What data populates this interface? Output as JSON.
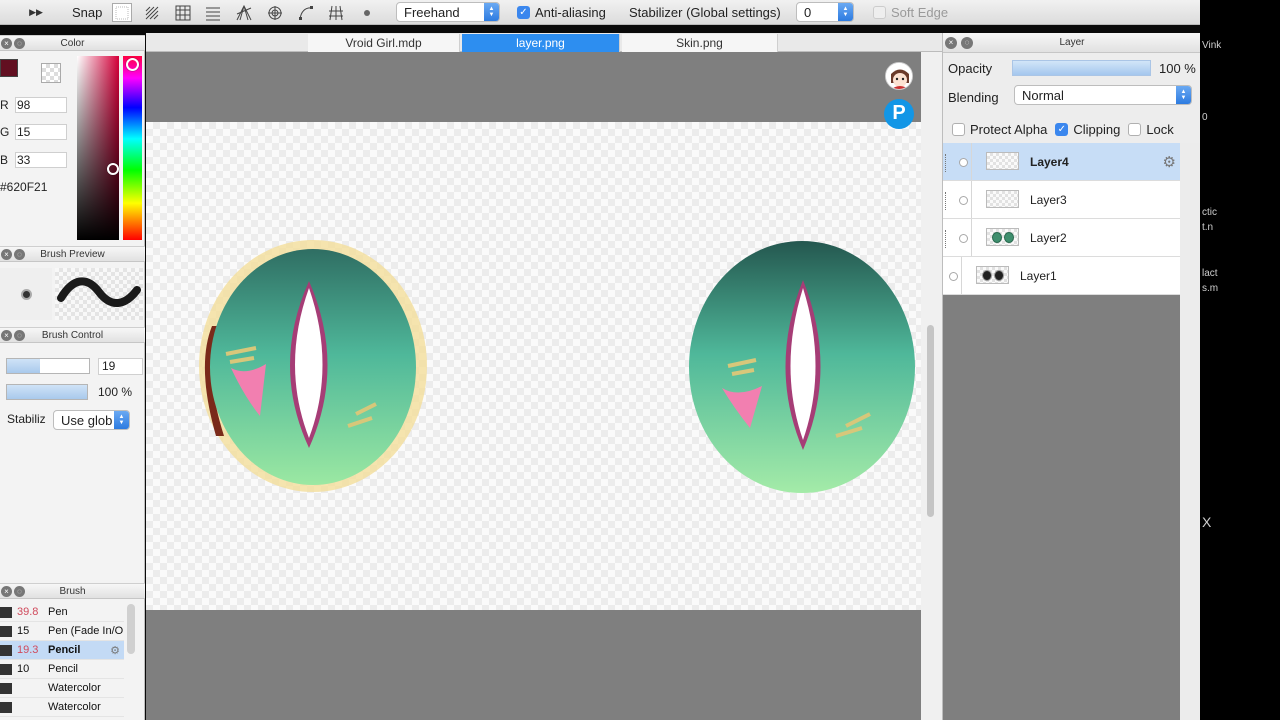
{
  "toolbar": {
    "snap_label": "Snap",
    "stroke_mode": "Freehand",
    "anti_aliasing_label": "Anti-aliasing",
    "stabilizer_label": "Stabilizer (Global settings)",
    "stabilizer_value": "0",
    "soft_edge_label": "Soft Edge"
  },
  "tabs": [
    {
      "label": "Vroid Girl.mdp",
      "active": false
    },
    {
      "label": "layer.png",
      "active": true
    },
    {
      "label": "Skin.png",
      "active": false
    }
  ],
  "color_panel": {
    "title": "Color",
    "r_label": "R",
    "r_value": "98",
    "g_label": "G",
    "g_value": "15",
    "b_label": "B",
    "b_value": "33",
    "hex": "#620F21",
    "foreground_color": "#620F21"
  },
  "brush_preview": {
    "title": "Brush Preview"
  },
  "brush_control": {
    "title": "Brush Control",
    "size_value": "19",
    "size_fraction": 0.4,
    "opacity_value": "100 %",
    "opacity_fraction": 1.0,
    "stabilizer_label": "Stabiliz",
    "stabilizer_option": "Use glob"
  },
  "brush_panel": {
    "title": "Brush",
    "items": [
      {
        "size": "39.8",
        "name": "Pen",
        "selected": false,
        "red": true
      },
      {
        "size": "15",
        "name": "Pen (Fade In/O",
        "selected": false,
        "red": false
      },
      {
        "size": "19.3",
        "name": "Pencil",
        "selected": true,
        "red": true
      },
      {
        "size": "10",
        "name": "Pencil",
        "selected": false,
        "red": false
      },
      {
        "size": "",
        "name": "Watercolor",
        "selected": false,
        "red": false
      },
      {
        "size": "",
        "name": "Watercolor",
        "selected": false,
        "red": false
      }
    ]
  },
  "layer_panel": {
    "title": "Layer",
    "opacity_label": "Opacity",
    "opacity_value": "100 %",
    "blending_label": "Blending",
    "blending_value": "Normal",
    "protect_alpha_label": "Protect Alpha",
    "clipping_label": "Clipping",
    "lock_label": "Lock",
    "layers": [
      {
        "name": "Layer4",
        "selected": true
      },
      {
        "name": "Layer3",
        "selected": false
      },
      {
        "name": "Layer2",
        "selected": false
      },
      {
        "name": "Layer1",
        "selected": false
      }
    ]
  },
  "side_strip": {
    "lines": [
      "Vink",
      "0",
      "ctic",
      "t.n",
      "lact",
      "s.m",
      "X"
    ]
  },
  "icons": {
    "play": "play-icon",
    "settings": "gear-icon",
    "close": "close-icon",
    "pixiv": "pixiv-icon"
  },
  "colors": {
    "accent": "#2d8ef0",
    "selected_row": "#c7ddf6",
    "canvas_bg": "#7f7f7f"
  }
}
